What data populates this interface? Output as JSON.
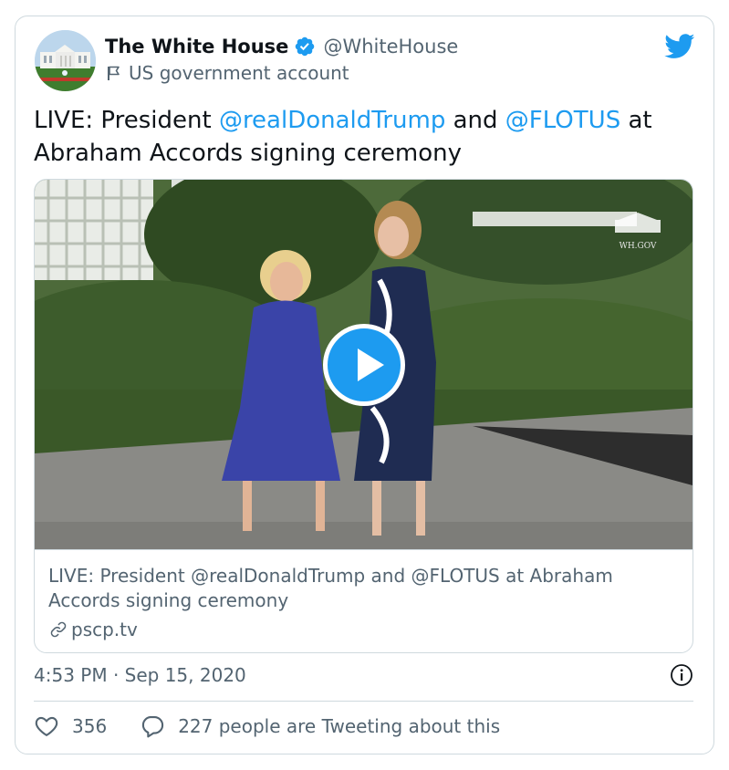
{
  "author": {
    "display_name": "The White House",
    "handle": "@WhiteHouse",
    "account_label": "US government account",
    "avatar_icon": "white-house-avatar",
    "verified_icon": "verified-badge-icon"
  },
  "tweet": {
    "text_parts": {
      "prefix": "LIVE: President ",
      "mention1": "@realDonaldTrump",
      "middle": " and ",
      "mention2": "@FLOTUS",
      "suffix": " at Abraham Accords signing ceremony"
    }
  },
  "media": {
    "watermark": "WH.GOV",
    "play_icon": "play-icon",
    "link_title": "LIVE: President @realDonaldTrump and @FLOTUS at Abraham Accords signing ceremony",
    "link_domain": "pscp.tv"
  },
  "meta": {
    "timestamp": "4:53 PM · Sep 15, 2020"
  },
  "actions": {
    "likes": "356",
    "reply_text": "227 people are Tweeting about this"
  },
  "colors": {
    "accent": "#1d9bf0",
    "secondary_text": "#536471",
    "border": "#cfd9de"
  }
}
